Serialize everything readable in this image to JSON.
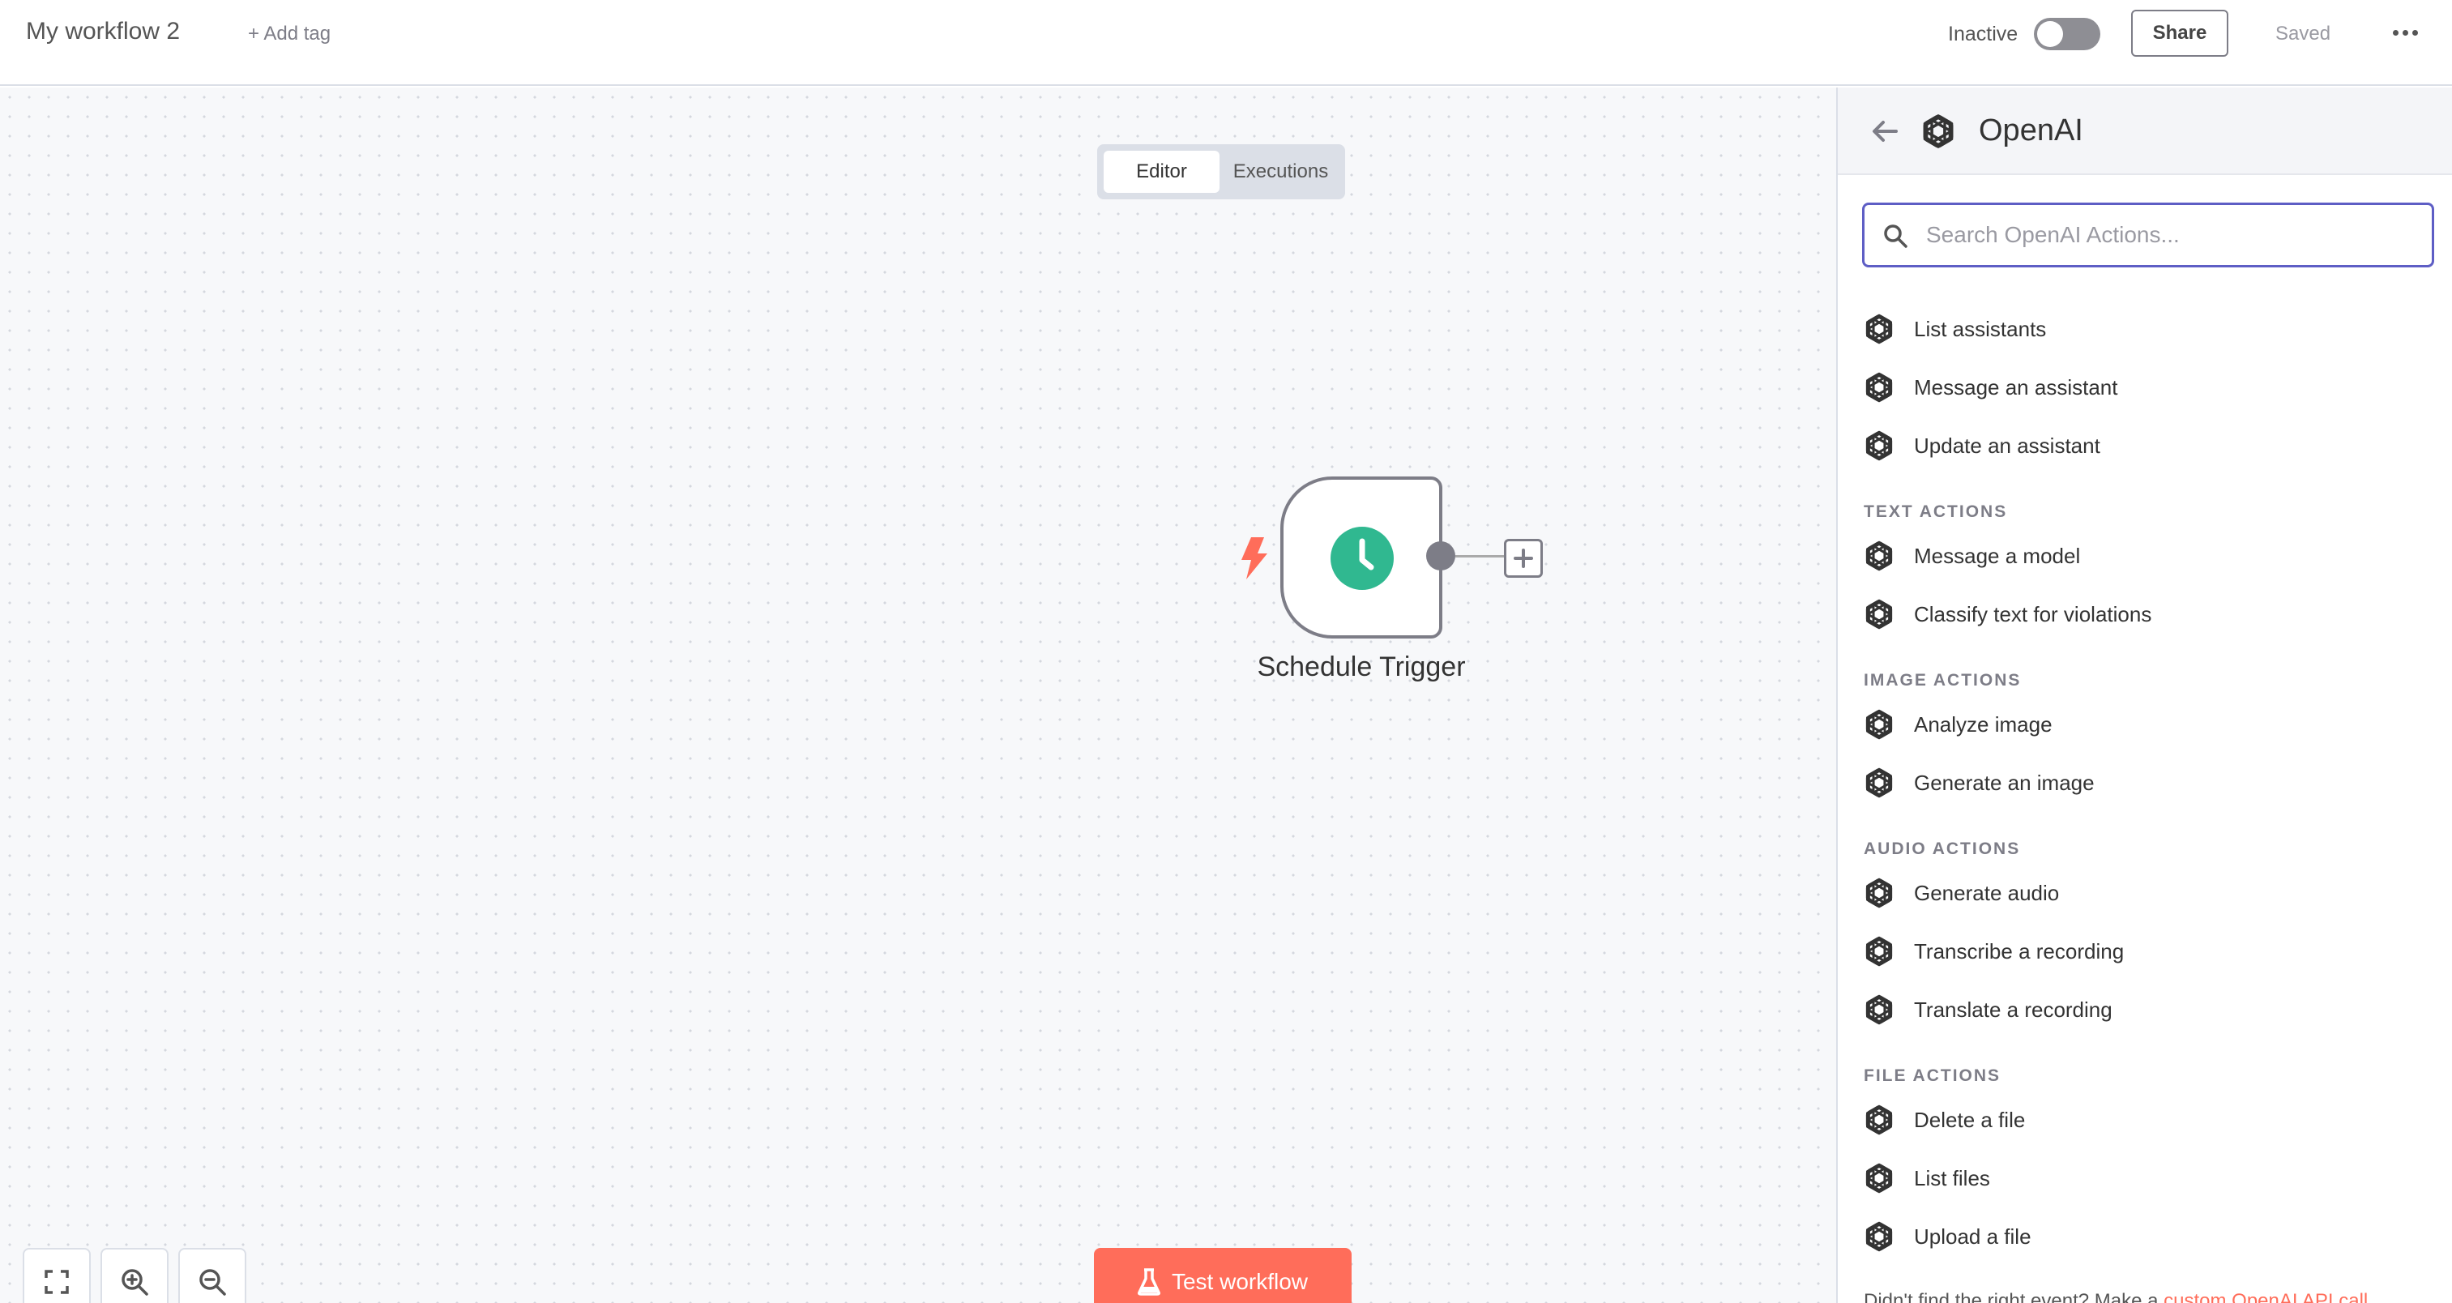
{
  "header": {
    "workflow_title": "My workflow 2",
    "add_tag": "+ Add tag",
    "status": "Inactive",
    "share": "Share",
    "saved": "Saved"
  },
  "tabs": {
    "editor": "Editor",
    "executions": "Executions"
  },
  "node": {
    "label": "Schedule Trigger",
    "icon": "clock-icon",
    "color": "#30b890"
  },
  "canvas": {
    "test_button": "Test workflow",
    "accent": "#ff6d5a"
  },
  "panel": {
    "title": "OpenAI",
    "search_placeholder": "Search OpenAI Actions...",
    "actions_assistant": [
      "List assistants",
      "Message an assistant",
      "Update an assistant"
    ],
    "text_section": "TEXT ACTIONS",
    "actions_text": [
      "Message a model",
      "Classify text for violations"
    ],
    "image_section": "IMAGE ACTIONS",
    "actions_image": [
      "Analyze image",
      "Generate an image"
    ],
    "audio_section": "AUDIO ACTIONS",
    "actions_audio": [
      "Generate audio",
      "Transcribe a recording",
      "Translate a recording"
    ],
    "file_section": "FILE ACTIONS",
    "actions_file": [
      "Delete a file",
      "List files",
      "Upload a file"
    ],
    "footer_text": "Didn't find the right event? Make a ",
    "footer_link": "custom OpenAI API call"
  }
}
